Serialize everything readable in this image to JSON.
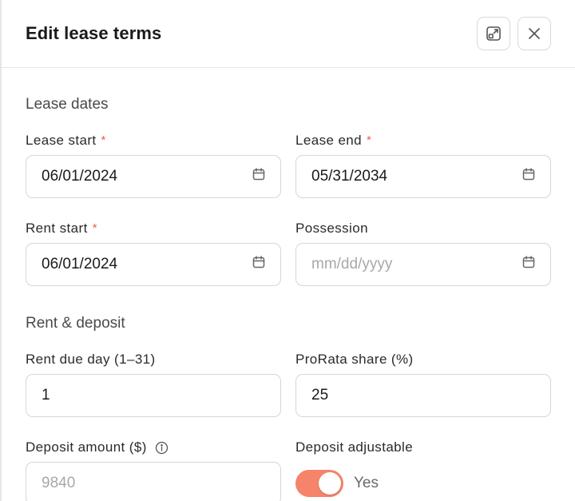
{
  "header": {
    "title": "Edit lease terms"
  },
  "sections": {
    "dates_title": "Lease dates",
    "rent_title": "Rent & deposit"
  },
  "fields": {
    "lease_start": {
      "label": "Lease start",
      "required": "*",
      "value": "06/01/2024"
    },
    "lease_end": {
      "label": "Lease end",
      "required": "*",
      "value": "05/31/2034"
    },
    "rent_start": {
      "label": "Rent start",
      "required": "*",
      "value": "06/01/2024"
    },
    "possession": {
      "label": "Possession",
      "placeholder": "mm/dd/yyyy",
      "value": ""
    },
    "rent_due_day": {
      "label": "Rent due day (1–31)",
      "value": "1"
    },
    "prorata_share": {
      "label": "ProRata share (%)",
      "value": "25"
    },
    "deposit_amount": {
      "label": "Deposit amount ($)",
      "value": "9840"
    },
    "deposit_adjustable": {
      "label": "Deposit adjustable",
      "toggle_text": "Yes",
      "checked": true
    }
  },
  "colors": {
    "accent": "#f5846a",
    "required": "#e8604a"
  },
  "icons": {
    "expand": "expand-icon",
    "close": "close-icon",
    "calendar": "calendar-icon",
    "info": "info-icon"
  }
}
